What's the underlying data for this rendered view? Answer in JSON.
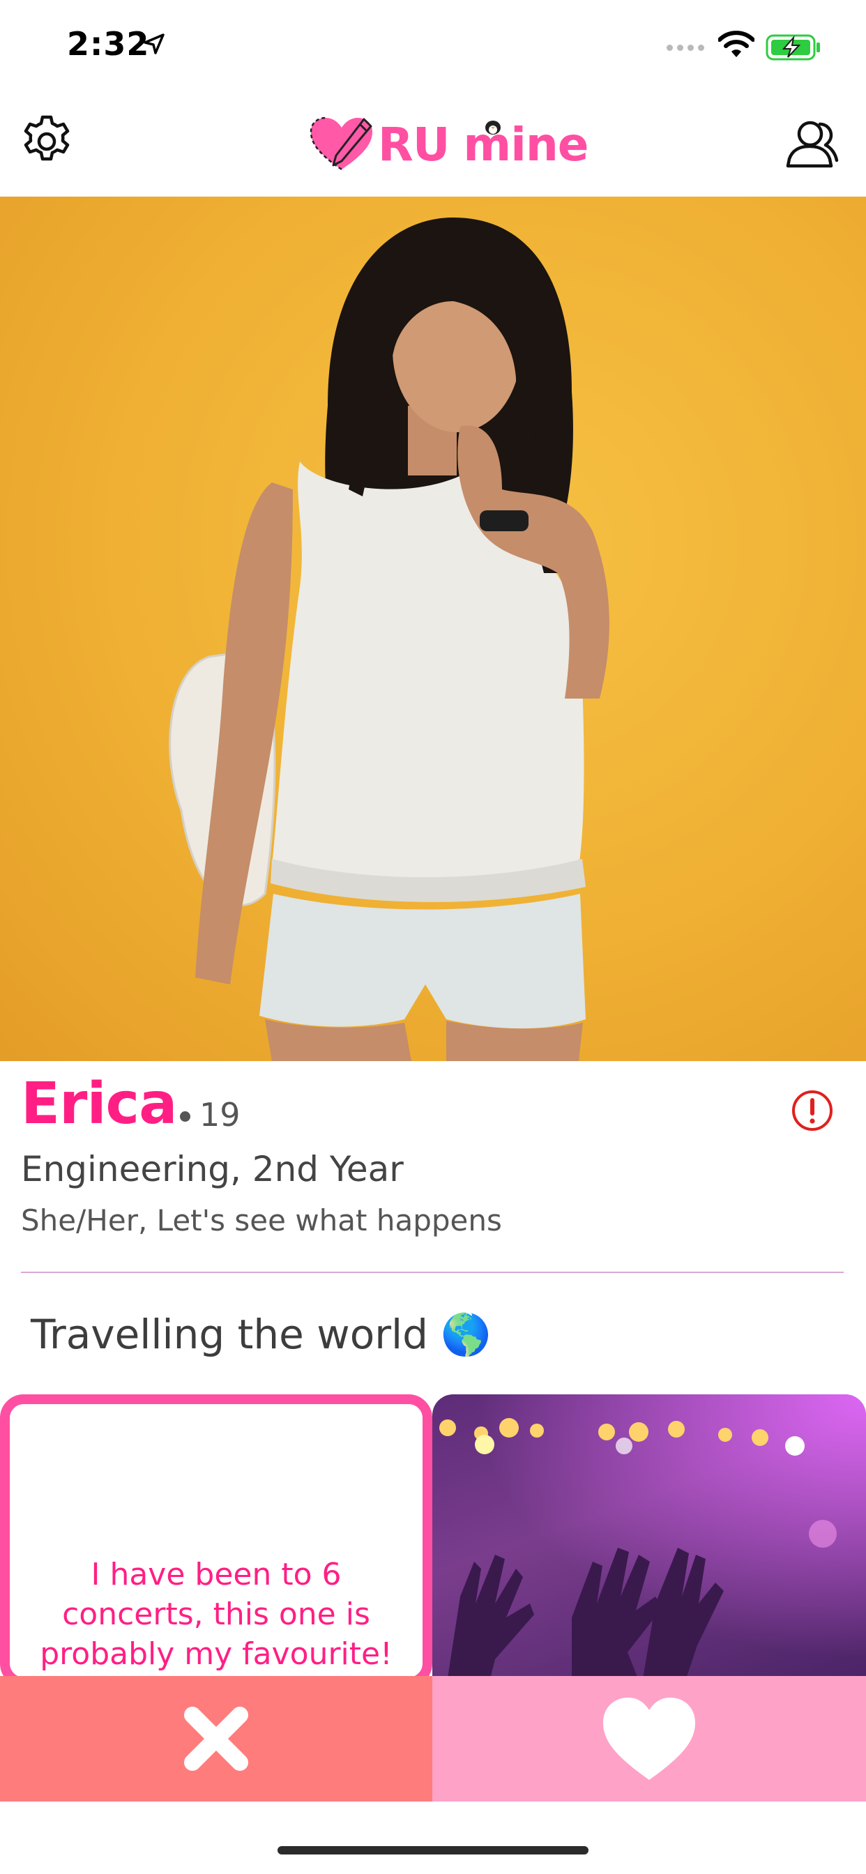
{
  "status_bar": {
    "time": "2:32"
  },
  "header": {
    "logo_ru": "RU",
    "logo_mine": "mine",
    "settings_icon": "gear-icon",
    "profile_icon": "profile-icon"
  },
  "profile": {
    "name": "Erica",
    "age": "19",
    "major": "Engineering, 2nd Year",
    "pronouns_tagline": "She/Her, Let's see what happens",
    "prompt": "Travelling the world 🌎",
    "card_text": "I have been to 6 concerts, this one is probably my favourite!"
  },
  "actions": {
    "nope_icon": "close-icon",
    "like_icon": "heart-icon"
  },
  "colors": {
    "brand_pink": "#ff4fa3",
    "name_pink": "#ff1f84",
    "nope_bg": "#ff7c7c",
    "like_bg": "#ffa2c8",
    "hero_bg": "#f0b436"
  }
}
